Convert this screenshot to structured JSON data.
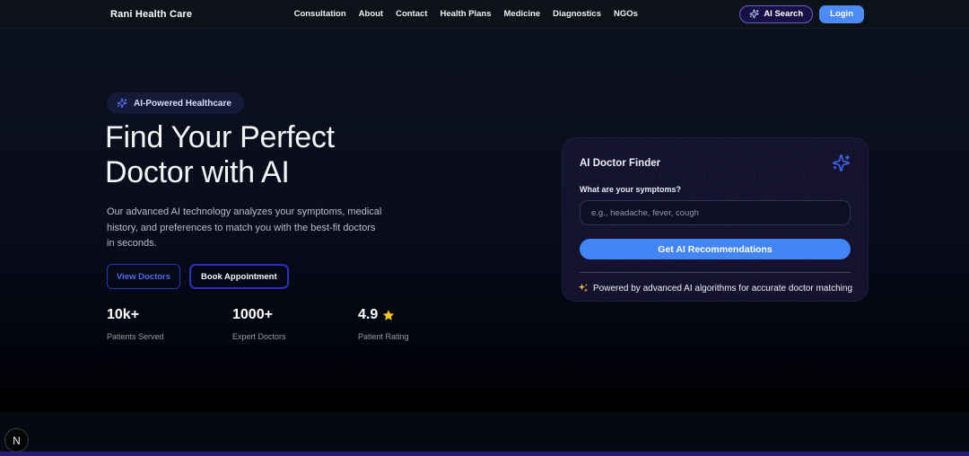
{
  "header": {
    "logo": "Rani Health Care",
    "nav": [
      "Consultation",
      "About",
      "Contact",
      "Health Plans",
      "Medicine",
      "Diagnostics",
      "NGOs"
    ],
    "ai_search_label": "AI Search",
    "login_label": "Login"
  },
  "hero": {
    "badge_label": "AI-Powered Healthcare",
    "title_line1": "Find Your Perfect",
    "title_line2": "Doctor with AI",
    "description": "Our advanced AI technology analyzes your symptoms, medical history, and preferences to match you with the best-fit doctors in seconds.",
    "view_doctors_label": "View Doctors",
    "book_appointment_label": "Book Appointment",
    "stats": [
      {
        "value": "10k+",
        "label": "Patients Served"
      },
      {
        "value": "1000+",
        "label": "Expert Doctors"
      },
      {
        "value": "4.9",
        "label": "Patient Rating",
        "icon": "star-icon"
      }
    ]
  },
  "finder": {
    "title": "AI Doctor Finder",
    "symptoms_label": "What are your symptoms?",
    "symptoms_placeholder": "e.g., headache, fever, cough",
    "submit_label": "Get AI Recommendations",
    "footnote": "Powered by advanced AI algorithms for accurate doctor matching"
  },
  "dev_badge_label": "N",
  "colors": {
    "accent_blue": "#4285f4",
    "login_blue": "#4b8bf3",
    "ai_search_border": "#7159d8",
    "star_gold": "#f5c518",
    "bottom_stripe": "#261b76",
    "badge_bg": "#151a38",
    "card_bg": "#14122c"
  }
}
